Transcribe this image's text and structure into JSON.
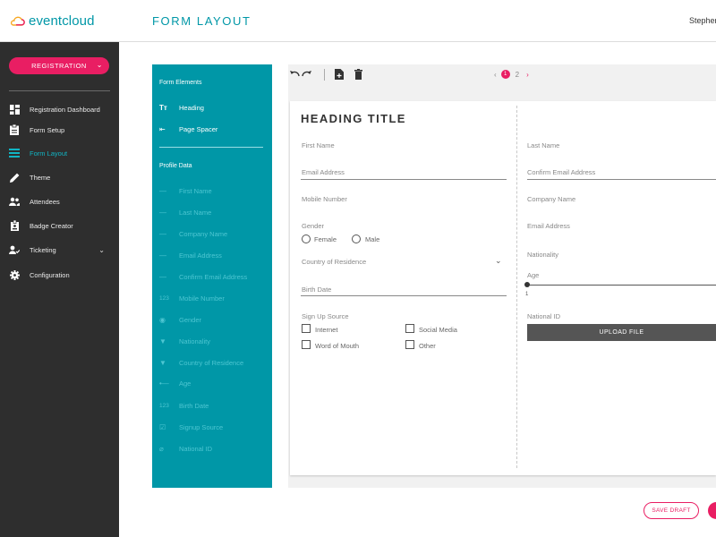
{
  "header": {
    "logo_text": "eventcloud",
    "page_title": "FORM LAYOUT",
    "user_name": "Stephen",
    "brand_color": "#0097a7",
    "accent_color": "#e91e63"
  },
  "sidebar": {
    "primary_button": "REGISTRATION",
    "items": [
      {
        "label": "Registration Dashboard",
        "icon": "dashboard-icon"
      },
      {
        "label": "Form Setup",
        "icon": "clipboard-icon"
      },
      {
        "label": "Form Layout",
        "icon": "layout-icon",
        "active": true
      },
      {
        "label": "Theme",
        "icon": "pencil-icon"
      },
      {
        "label": "Attendees",
        "icon": "people-icon"
      },
      {
        "label": "Badge Creator",
        "icon": "badge-icon"
      },
      {
        "label": "Ticketing",
        "icon": "ticket-icon"
      },
      {
        "label": "Configuration",
        "icon": "gear-icon"
      }
    ]
  },
  "elements_panel": {
    "form_elements_heading": "Form Elements",
    "form_elements": [
      {
        "label": "Heading",
        "icon": "text-heading-icon",
        "glyph": "Tт"
      },
      {
        "label": "Page Spacer",
        "icon": "page-spacer-icon",
        "glyph": "⇤"
      }
    ],
    "profile_data_heading": "Profile Data",
    "profile_fields": [
      {
        "label": "First Name",
        "icon": "text-field-icon",
        "glyph": "—"
      },
      {
        "label": "Last Name",
        "icon": "text-field-icon",
        "glyph": "—"
      },
      {
        "label": "Company Name",
        "icon": "text-field-icon",
        "glyph": "—"
      },
      {
        "label": "Email Address",
        "icon": "text-field-icon",
        "glyph": "—"
      },
      {
        "label": "Confirm Email Address",
        "icon": "text-field-icon",
        "glyph": "—"
      },
      {
        "label": "Mobile Number",
        "icon": "number-icon",
        "glyph": "123"
      },
      {
        "label": "Gender",
        "icon": "radio-icon",
        "glyph": "◉"
      },
      {
        "label": "Nationality",
        "icon": "dropdown-icon",
        "glyph": "▼"
      },
      {
        "label": "Country of Residence",
        "icon": "dropdown-icon",
        "glyph": "▼"
      },
      {
        "label": "Age",
        "icon": "slider-icon",
        "glyph": "•—"
      },
      {
        "label": "Birth Date",
        "icon": "number-icon",
        "glyph": "123"
      },
      {
        "label": "Signup Source",
        "icon": "checkbox-icon",
        "glyph": "☑"
      },
      {
        "label": "National ID",
        "icon": "attachment-icon",
        "glyph": "⌀"
      }
    ]
  },
  "toolbar": {
    "pager_prev": "‹",
    "current_page": "1",
    "total_pages": "2",
    "pager_next": "›",
    "more": "⋮"
  },
  "form": {
    "heading": "HEADING TITLE",
    "left": {
      "first_name": "First Name",
      "email": "Email Address",
      "mobile": "Mobile Number",
      "gender": "Gender",
      "gender_options": [
        "Female",
        "Male"
      ],
      "country": "Country of Residence",
      "birth_date": "Birth Date",
      "signup_source": "Sign Up Source",
      "signup_options": [
        "Internet",
        "Social Media",
        "Word of Mouth",
        "Other"
      ]
    },
    "right": {
      "last_name": "Last Name",
      "confirm_email": "Confirm Email Address",
      "company": "Company Name",
      "email": "Email Address",
      "nationality": "Nationality",
      "age": "Age",
      "age_min": "1",
      "national_id": "National ID",
      "upload": "UPLOAD FILE"
    }
  },
  "actions": {
    "save_draft": "SAVE DRAFT"
  }
}
